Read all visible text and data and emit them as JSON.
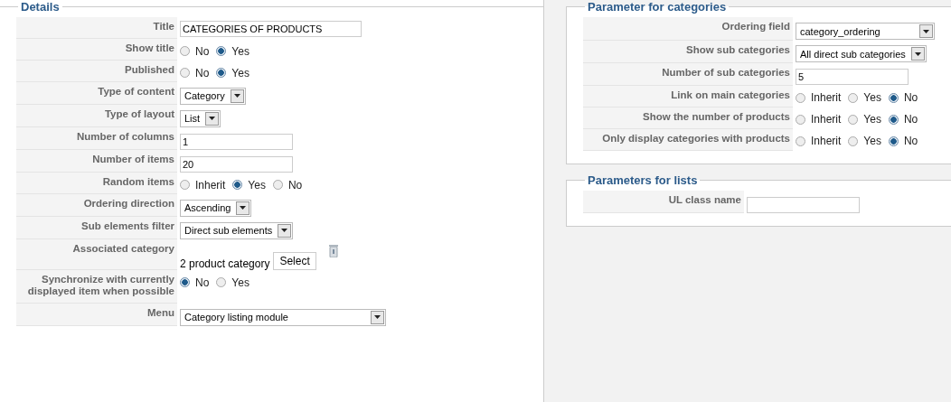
{
  "panels": [
    {
      "legend": "Details",
      "fields": [
        {
          "label": "Title",
          "kind": "long-text",
          "value": "CATEGORIES OF PRODUCTS"
        },
        {
          "label": "Show title",
          "kind": "radio",
          "options": [
            {
              "label": "No",
              "selected": false
            },
            {
              "label": "Yes",
              "selected": true
            }
          ]
        },
        {
          "label": "Published",
          "kind": "radio",
          "options": [
            {
              "label": "No",
              "selected": false
            },
            {
              "label": "Yes",
              "selected": true
            }
          ]
        },
        {
          "label": "Type of content",
          "kind": "select",
          "value": "Category"
        },
        {
          "label": "Type of layout",
          "kind": "select",
          "value": "List"
        },
        {
          "label": "Number of columns",
          "kind": "text",
          "value": "1"
        },
        {
          "label": "Number of items",
          "kind": "text",
          "value": "20"
        },
        {
          "label": "Random items",
          "kind": "radio",
          "options": [
            {
              "label": "Inherit",
              "selected": false
            },
            {
              "label": "Yes",
              "selected": true
            },
            {
              "label": "No",
              "selected": false
            }
          ]
        },
        {
          "label": "Ordering direction",
          "kind": "select",
          "value": "Ascending"
        },
        {
          "label": "Sub elements filter",
          "kind": "select",
          "value": "Direct sub elements"
        },
        {
          "label": "Associated category",
          "kind": "picker",
          "value": "2 product category",
          "button": "Select"
        },
        {
          "label": "Synchronize with currently displayed item when possible",
          "kind": "radio",
          "options": [
            {
              "label": "No",
              "selected": true
            },
            {
              "label": "Yes",
              "selected": false
            }
          ]
        },
        {
          "label": "Menu",
          "kind": "long-select",
          "value": "Category listing module"
        }
      ]
    },
    {
      "legend": "Parameter for categories",
      "fields": [
        {
          "label": "Ordering field",
          "kind": "long-select",
          "value": "category_ordering"
        },
        {
          "label": "Show sub categories",
          "kind": "select",
          "value": "All direct sub categories"
        },
        {
          "label": "Number of sub categories",
          "kind": "text",
          "value": "5"
        },
        {
          "label": "Link on main categories",
          "kind": "radio",
          "options": [
            {
              "label": "Inherit",
              "selected": false
            },
            {
              "label": "Yes",
              "selected": false
            },
            {
              "label": "No",
              "selected": true
            }
          ]
        },
        {
          "label": "Show the number of products",
          "kind": "radio",
          "options": [
            {
              "label": "Inherit",
              "selected": false
            },
            {
              "label": "Yes",
              "selected": false
            },
            {
              "label": "No",
              "selected": true
            }
          ]
        },
        {
          "label": "Only display categories with products",
          "kind": "radio",
          "options": [
            {
              "label": "Inherit",
              "selected": false
            },
            {
              "label": "Yes",
              "selected": false
            },
            {
              "label": "No",
              "selected": true
            }
          ]
        }
      ]
    },
    {
      "legend": "Parameters for lists",
      "fields": [
        {
          "label": "UL class name",
          "kind": "text"
        }
      ]
    }
  ]
}
